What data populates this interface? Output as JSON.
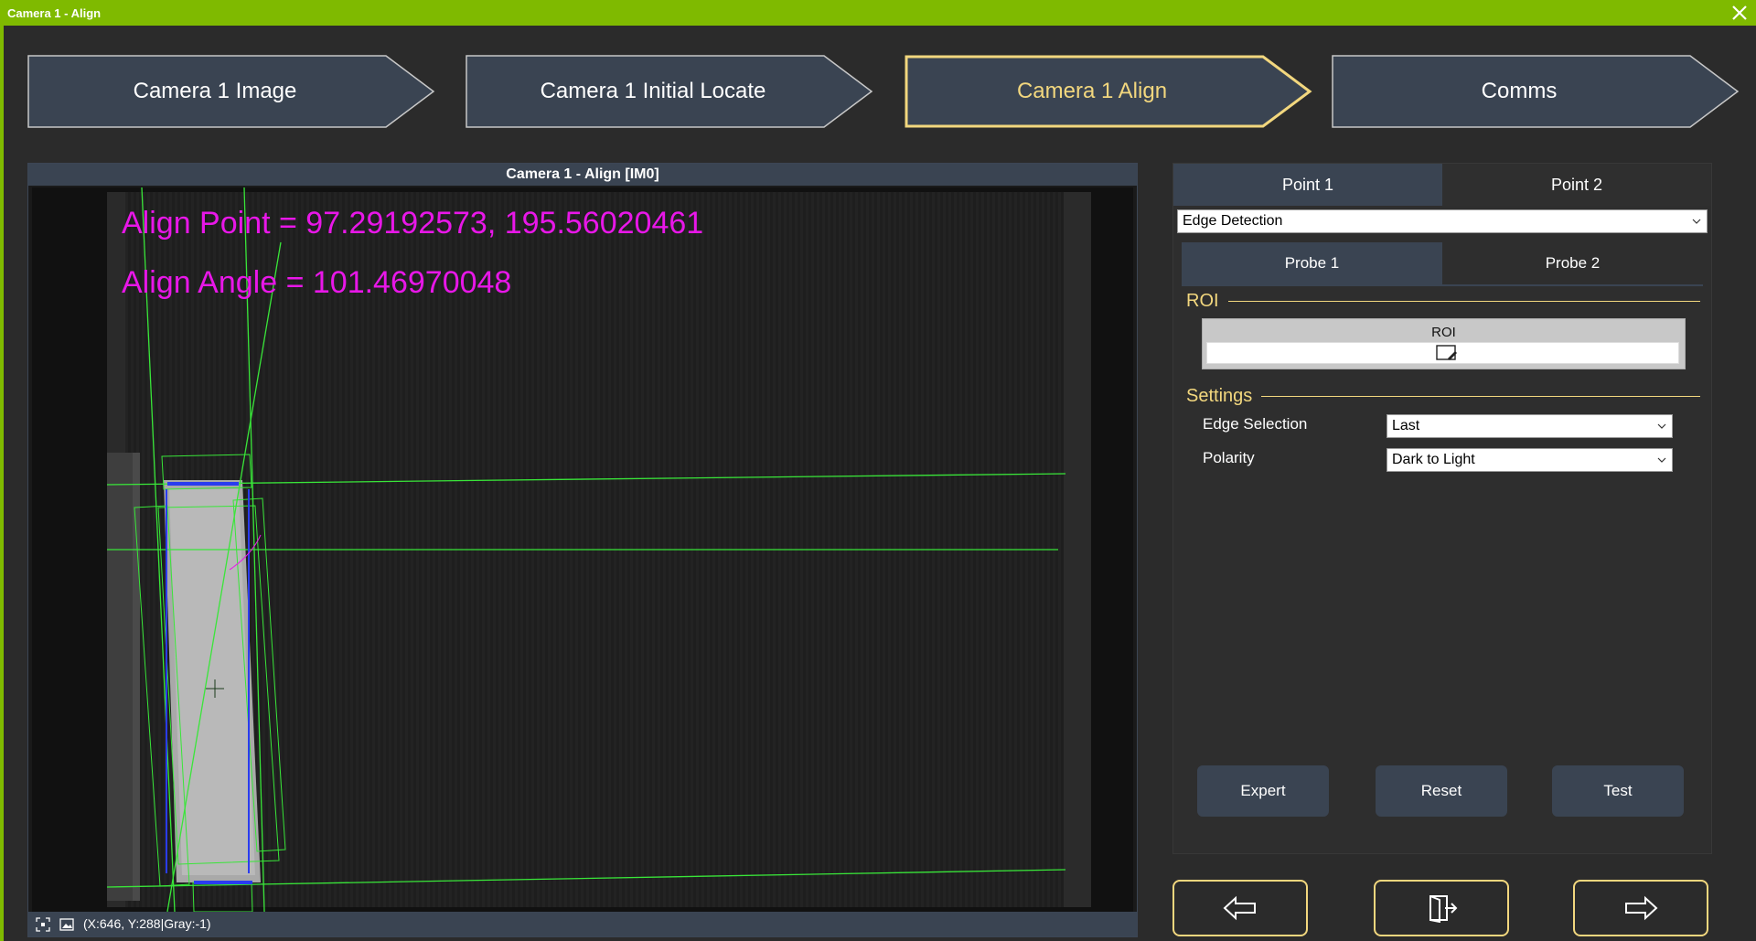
{
  "window": {
    "title": "Camera 1 - Align"
  },
  "steps": [
    {
      "label": "Camera 1 Image",
      "active": false
    },
    {
      "label": "Camera 1 Initial Locate",
      "active": false
    },
    {
      "label": "Camera 1 Align",
      "active": true
    },
    {
      "label": "Comms",
      "active": false
    }
  ],
  "viewer": {
    "title": "Camera 1 - Align  [IM0]",
    "overlay_align_point": "Align Point = 97.29192573, 195.56020461",
    "overlay_align_angle": "Align Angle = 101.46970048",
    "status": "(X:646, Y:288|Gray:-1)"
  },
  "panel": {
    "point_tabs": [
      "Point 1",
      "Point 2"
    ],
    "tool_select": "Edge Detection",
    "probe_tabs": [
      "Probe 1",
      "Probe 2"
    ],
    "roi_section": "ROI",
    "roi_label": "ROI",
    "settings_section": "Settings",
    "edge_selection_label": "Edge Selection",
    "edge_selection_value": "Last",
    "polarity_label": "Polarity",
    "polarity_value": "Dark to Light",
    "buttons": {
      "expert": "Expert",
      "reset": "Reset",
      "test": "Test"
    }
  },
  "colors": {
    "titlebar": "#7fba00",
    "accent": "#f2d77e",
    "overlay_text": "#e817e8",
    "overlay_lines": "#39e639",
    "edge_points": "#2a3cf0"
  }
}
